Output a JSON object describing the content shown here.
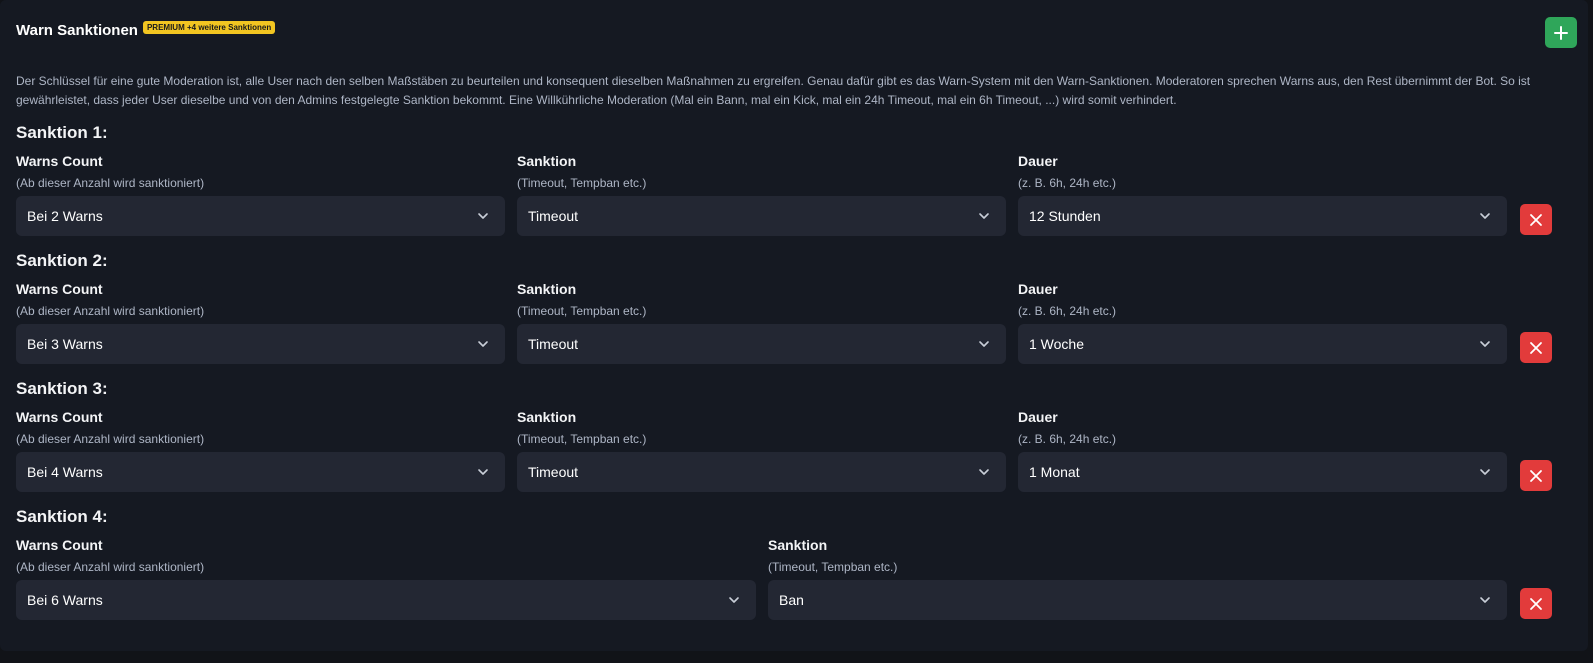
{
  "panel": {
    "title": "Warn Sanktionen",
    "badge": "PREMIUM +4 weitere Sanktionen",
    "add_icon": "plus-icon",
    "description": "Der Schlüssel für eine gute Moderation ist, alle User nach den selben Maßstäben zu beurteilen und konsequent dieselben Maßnahmen zu ergreifen. Genau dafür gibt es das Warn-System mit den Warn-Sanktionen. Moderatoren sprechen Warns aus, den Rest übernimmt der Bot. So ist gewährleistet, dass jeder User dieselbe und von den Admins festgelegte Sanktion bekommt. Eine Willkührliche Moderation (Mal ein Bann, mal ein Kick, mal ein 24h Timeout, mal ein 6h Timeout, ...) wird somit verhindert."
  },
  "labels": {
    "warns_count": "Warns Count",
    "warns_count_hint": "(Ab dieser Anzahl wird sanktioniert)",
    "sanktion": "Sanktion",
    "sanktion_hint": "(Timeout, Tempban etc.)",
    "dauer": "Dauer",
    "dauer_hint": "(z. B. 6h, 24h etc.)"
  },
  "sanctions": [
    {
      "title": "Sanktion 1:",
      "warns": "Bei 2 Warns",
      "sanktion": "Timeout",
      "dauer": "12 Stunden"
    },
    {
      "title": "Sanktion 2:",
      "warns": "Bei 3 Warns",
      "sanktion": "Timeout",
      "dauer": "1 Woche"
    },
    {
      "title": "Sanktion 3:",
      "warns": "Bei 4 Warns",
      "sanktion": "Timeout",
      "dauer": "1 Monat"
    },
    {
      "title": "Sanktion 4:",
      "warns": "Bei 6 Warns",
      "sanktion": "Ban"
    }
  ],
  "colors": {
    "add_button": "#2fa65a",
    "delete_button": "#e23b3b",
    "premium_badge": "#f2c521"
  }
}
